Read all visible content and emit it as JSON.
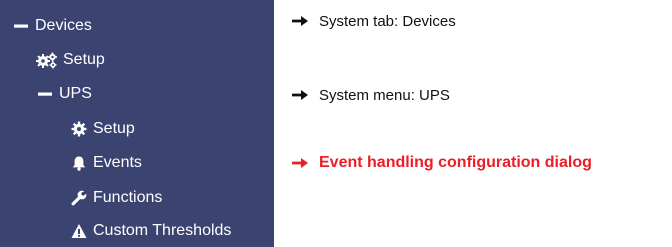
{
  "sidebar": {
    "devices_label": "Devices",
    "devices_setup_label": "Setup",
    "ups_label": "UPS",
    "ups_setup_label": "Setup",
    "events_label": "Events",
    "functions_label": "Functions",
    "custom_thresholds_label": "Custom Thresholds",
    "background_color": "#3b4371"
  },
  "annotations": {
    "system_tab": "System tab: Devices",
    "system_menu": "System menu: UPS",
    "event_dialog": "Event handling configuration dialog",
    "highlight_color": "#ee1c24"
  }
}
